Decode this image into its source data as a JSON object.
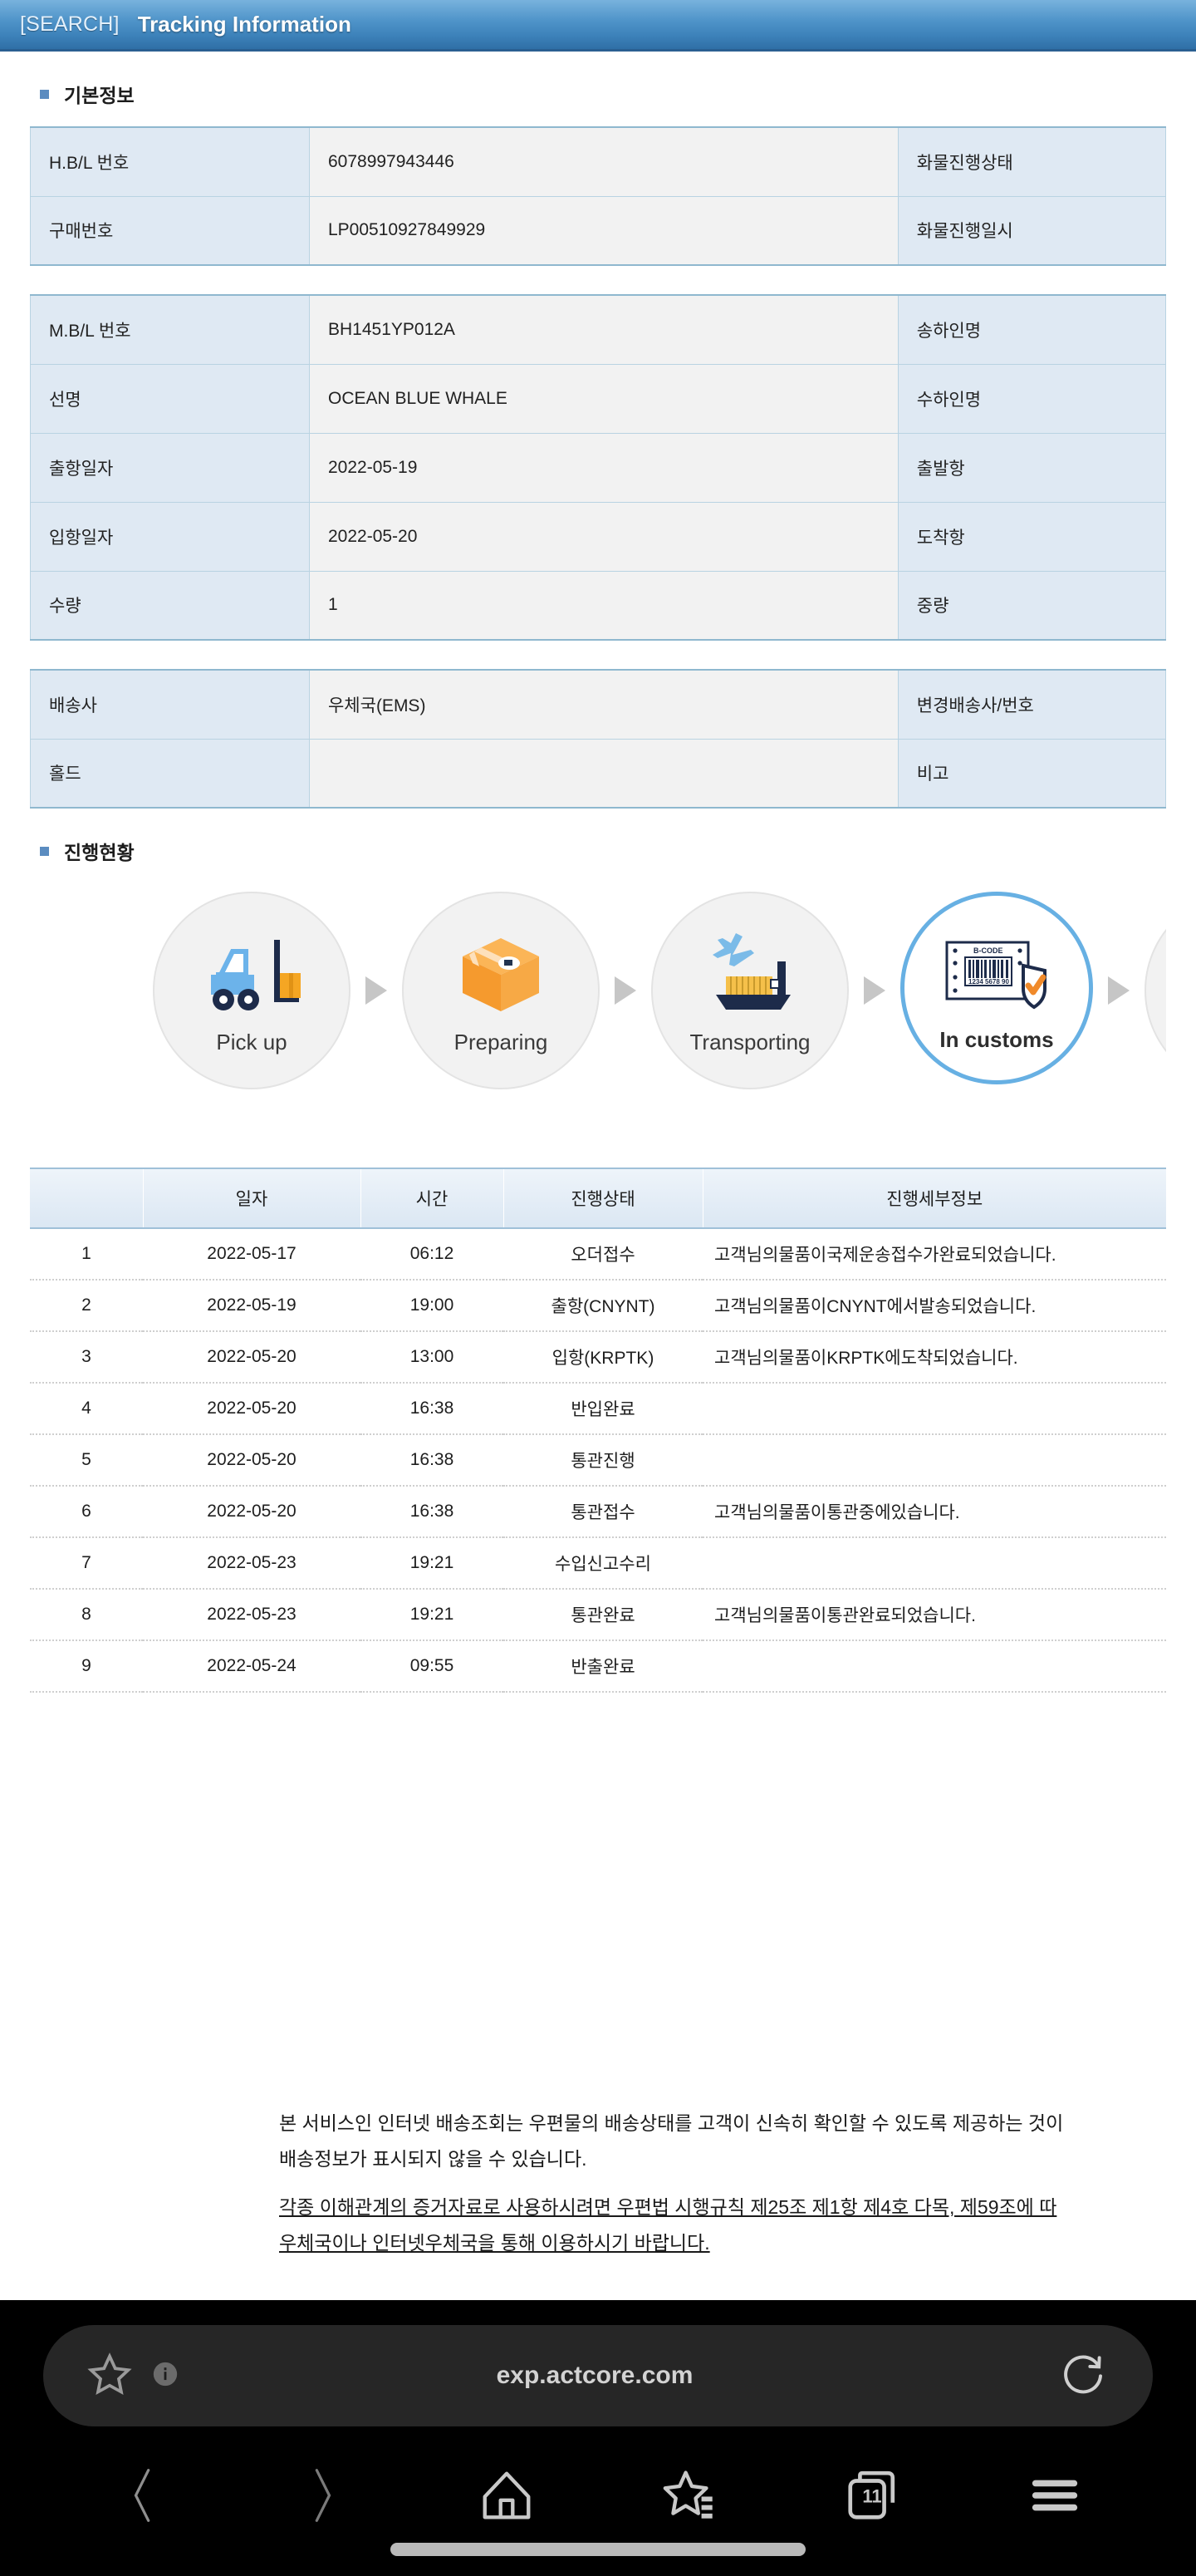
{
  "titlebar": {
    "search_tag": "[SEARCH]",
    "title": "Tracking Information"
  },
  "sections": {
    "basic_info_title": "기본정보",
    "progress_title": "진행현황"
  },
  "basic_table": {
    "rows": [
      {
        "label": "H.B/L 번호",
        "value": "6078997943446",
        "label2": "화물진행상태",
        "value2": ""
      },
      {
        "label": "구매번호",
        "value": "LP00510927849929",
        "label2": "화물진행일시",
        "value2": ""
      }
    ]
  },
  "shipment_table": {
    "rows": [
      {
        "label": "M.B/L 번호",
        "value": "BH1451YP012A",
        "label2": "송하인명",
        "value2": ""
      },
      {
        "label": "선명",
        "value": "OCEAN BLUE WHALE",
        "label2": "수하인명",
        "value2": ""
      },
      {
        "label": "출항일자",
        "value": "2022-05-19",
        "label2": "출발항",
        "value2": ""
      },
      {
        "label": "입항일자",
        "value": "2022-05-20",
        "label2": "도착항",
        "value2": ""
      },
      {
        "label": "수량",
        "value": "1",
        "label2": "중량",
        "value2": ""
      }
    ]
  },
  "courier_table": {
    "rows": [
      {
        "label": "배송사",
        "value": "우체국(EMS)",
        "label2": "변경배송사/번호",
        "value2": ""
      },
      {
        "label": "홀드",
        "value": "",
        "label2": "비고",
        "value2": ""
      }
    ]
  },
  "progress_steps": [
    {
      "label": "Pick up",
      "icon": "forklift-icon",
      "active": false
    },
    {
      "label": "Preparing",
      "icon": "package-box-icon",
      "active": false
    },
    {
      "label": "Transporting",
      "icon": "plane-ship-icon",
      "active": false
    },
    {
      "label": "In customs",
      "icon": "barcode-shield-icon",
      "active": true
    },
    {
      "label": "",
      "icon": "delivery-icon",
      "active": false
    }
  ],
  "history": {
    "headers": [
      "",
      "일자",
      "시간",
      "진행상태",
      "진행세부정보"
    ],
    "rows": [
      {
        "no": "1",
        "date": "2022-05-17",
        "time": "06:12",
        "state": "오더접수",
        "detail": "고객님의물품이국제운송접수가완료되었습니다."
      },
      {
        "no": "2",
        "date": "2022-05-19",
        "time": "19:00",
        "state": "출항(CNYNT)",
        "detail": "고객님의물품이CNYNT에서발송되었습니다."
      },
      {
        "no": "3",
        "date": "2022-05-20",
        "time": "13:00",
        "state": "입항(KRPTK)",
        "detail": "고객님의물품이KRPTK에도착되었습니다."
      },
      {
        "no": "4",
        "date": "2022-05-20",
        "time": "16:38",
        "state": "반입완료",
        "detail": ""
      },
      {
        "no": "5",
        "date": "2022-05-20",
        "time": "16:38",
        "state": "통관진행",
        "detail": ""
      },
      {
        "no": "6",
        "date": "2022-05-20",
        "time": "16:38",
        "state": "통관접수",
        "detail": "고객님의물품이통관중에있습니다."
      },
      {
        "no": "7",
        "date": "2022-05-23",
        "time": "19:21",
        "state": "수입신고수리",
        "detail": ""
      },
      {
        "no": "8",
        "date": "2022-05-23",
        "time": "19:21",
        "state": "통관완료",
        "detail": "고객님의물품이통관완료되었습니다."
      },
      {
        "no": "9",
        "date": "2022-05-24",
        "time": "09:55",
        "state": "반출완료",
        "detail": ""
      }
    ]
  },
  "notice": {
    "line1": "본 서비스인 인터넷 배송조회는 우편물의 배송상태를 고객이 신속히 확인할 수 있도록 제공하는 것이",
    "line2": "배송정보가 표시되지 않을 수 있습니다.",
    "line3": "각종 이해관계의 증거자료로 사용하시려면 우편법 시행규칙 제25조 제1항 제4호 다목, 제59조에 따",
    "line4": "우체국이나 인터넷우체국을 통해 이용하시기 바랍니다."
  },
  "browser": {
    "url": "exp.actcore.com",
    "tab_count": "11"
  }
}
